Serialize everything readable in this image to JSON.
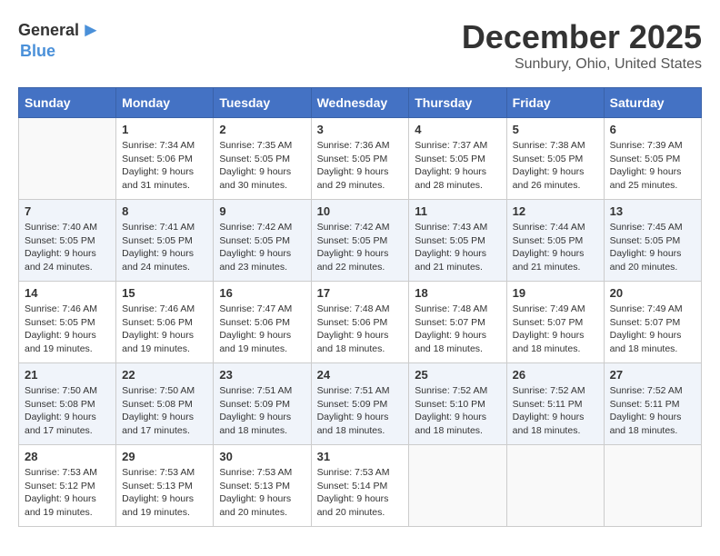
{
  "header": {
    "logo_general": "General",
    "logo_blue": "Blue",
    "month_title": "December 2025",
    "location": "Sunbury, Ohio, United States"
  },
  "days_of_week": [
    "Sunday",
    "Monday",
    "Tuesday",
    "Wednesday",
    "Thursday",
    "Friday",
    "Saturday"
  ],
  "weeks": [
    [
      {
        "day": "",
        "sunrise": "",
        "sunset": "",
        "daylight": ""
      },
      {
        "day": "1",
        "sunrise": "Sunrise: 7:34 AM",
        "sunset": "Sunset: 5:06 PM",
        "daylight": "Daylight: 9 hours and 31 minutes."
      },
      {
        "day": "2",
        "sunrise": "Sunrise: 7:35 AM",
        "sunset": "Sunset: 5:05 PM",
        "daylight": "Daylight: 9 hours and 30 minutes."
      },
      {
        "day": "3",
        "sunrise": "Sunrise: 7:36 AM",
        "sunset": "Sunset: 5:05 PM",
        "daylight": "Daylight: 9 hours and 29 minutes."
      },
      {
        "day": "4",
        "sunrise": "Sunrise: 7:37 AM",
        "sunset": "Sunset: 5:05 PM",
        "daylight": "Daylight: 9 hours and 28 minutes."
      },
      {
        "day": "5",
        "sunrise": "Sunrise: 7:38 AM",
        "sunset": "Sunset: 5:05 PM",
        "daylight": "Daylight: 9 hours and 26 minutes."
      },
      {
        "day": "6",
        "sunrise": "Sunrise: 7:39 AM",
        "sunset": "Sunset: 5:05 PM",
        "daylight": "Daylight: 9 hours and 25 minutes."
      }
    ],
    [
      {
        "day": "7",
        "sunrise": "Sunrise: 7:40 AM",
        "sunset": "Sunset: 5:05 PM",
        "daylight": "Daylight: 9 hours and 24 minutes."
      },
      {
        "day": "8",
        "sunrise": "Sunrise: 7:41 AM",
        "sunset": "Sunset: 5:05 PM",
        "daylight": "Daylight: 9 hours and 24 minutes."
      },
      {
        "day": "9",
        "sunrise": "Sunrise: 7:42 AM",
        "sunset": "Sunset: 5:05 PM",
        "daylight": "Daylight: 9 hours and 23 minutes."
      },
      {
        "day": "10",
        "sunrise": "Sunrise: 7:42 AM",
        "sunset": "Sunset: 5:05 PM",
        "daylight": "Daylight: 9 hours and 22 minutes."
      },
      {
        "day": "11",
        "sunrise": "Sunrise: 7:43 AM",
        "sunset": "Sunset: 5:05 PM",
        "daylight": "Daylight: 9 hours and 21 minutes."
      },
      {
        "day": "12",
        "sunrise": "Sunrise: 7:44 AM",
        "sunset": "Sunset: 5:05 PM",
        "daylight": "Daylight: 9 hours and 21 minutes."
      },
      {
        "day": "13",
        "sunrise": "Sunrise: 7:45 AM",
        "sunset": "Sunset: 5:05 PM",
        "daylight": "Daylight: 9 hours and 20 minutes."
      }
    ],
    [
      {
        "day": "14",
        "sunrise": "Sunrise: 7:46 AM",
        "sunset": "Sunset: 5:05 PM",
        "daylight": "Daylight: 9 hours and 19 minutes."
      },
      {
        "day": "15",
        "sunrise": "Sunrise: 7:46 AM",
        "sunset": "Sunset: 5:06 PM",
        "daylight": "Daylight: 9 hours and 19 minutes."
      },
      {
        "day": "16",
        "sunrise": "Sunrise: 7:47 AM",
        "sunset": "Sunset: 5:06 PM",
        "daylight": "Daylight: 9 hours and 19 minutes."
      },
      {
        "day": "17",
        "sunrise": "Sunrise: 7:48 AM",
        "sunset": "Sunset: 5:06 PM",
        "daylight": "Daylight: 9 hours and 18 minutes."
      },
      {
        "day": "18",
        "sunrise": "Sunrise: 7:48 AM",
        "sunset": "Sunset: 5:07 PM",
        "daylight": "Daylight: 9 hours and 18 minutes."
      },
      {
        "day": "19",
        "sunrise": "Sunrise: 7:49 AM",
        "sunset": "Sunset: 5:07 PM",
        "daylight": "Daylight: 9 hours and 18 minutes."
      },
      {
        "day": "20",
        "sunrise": "Sunrise: 7:49 AM",
        "sunset": "Sunset: 5:07 PM",
        "daylight": "Daylight: 9 hours and 18 minutes."
      }
    ],
    [
      {
        "day": "21",
        "sunrise": "Sunrise: 7:50 AM",
        "sunset": "Sunset: 5:08 PM",
        "daylight": "Daylight: 9 hours and 17 minutes."
      },
      {
        "day": "22",
        "sunrise": "Sunrise: 7:50 AM",
        "sunset": "Sunset: 5:08 PM",
        "daylight": "Daylight: 9 hours and 17 minutes."
      },
      {
        "day": "23",
        "sunrise": "Sunrise: 7:51 AM",
        "sunset": "Sunset: 5:09 PM",
        "daylight": "Daylight: 9 hours and 18 minutes."
      },
      {
        "day": "24",
        "sunrise": "Sunrise: 7:51 AM",
        "sunset": "Sunset: 5:09 PM",
        "daylight": "Daylight: 9 hours and 18 minutes."
      },
      {
        "day": "25",
        "sunrise": "Sunrise: 7:52 AM",
        "sunset": "Sunset: 5:10 PM",
        "daylight": "Daylight: 9 hours and 18 minutes."
      },
      {
        "day": "26",
        "sunrise": "Sunrise: 7:52 AM",
        "sunset": "Sunset: 5:11 PM",
        "daylight": "Daylight: 9 hours and 18 minutes."
      },
      {
        "day": "27",
        "sunrise": "Sunrise: 7:52 AM",
        "sunset": "Sunset: 5:11 PM",
        "daylight": "Daylight: 9 hours and 18 minutes."
      }
    ],
    [
      {
        "day": "28",
        "sunrise": "Sunrise: 7:53 AM",
        "sunset": "Sunset: 5:12 PM",
        "daylight": "Daylight: 9 hours and 19 minutes."
      },
      {
        "day": "29",
        "sunrise": "Sunrise: 7:53 AM",
        "sunset": "Sunset: 5:13 PM",
        "daylight": "Daylight: 9 hours and 19 minutes."
      },
      {
        "day": "30",
        "sunrise": "Sunrise: 7:53 AM",
        "sunset": "Sunset: 5:13 PM",
        "daylight": "Daylight: 9 hours and 20 minutes."
      },
      {
        "day": "31",
        "sunrise": "Sunrise: 7:53 AM",
        "sunset": "Sunset: 5:14 PM",
        "daylight": "Daylight: 9 hours and 20 minutes."
      },
      {
        "day": "",
        "sunrise": "",
        "sunset": "",
        "daylight": ""
      },
      {
        "day": "",
        "sunrise": "",
        "sunset": "",
        "daylight": ""
      },
      {
        "day": "",
        "sunrise": "",
        "sunset": "",
        "daylight": ""
      }
    ]
  ]
}
